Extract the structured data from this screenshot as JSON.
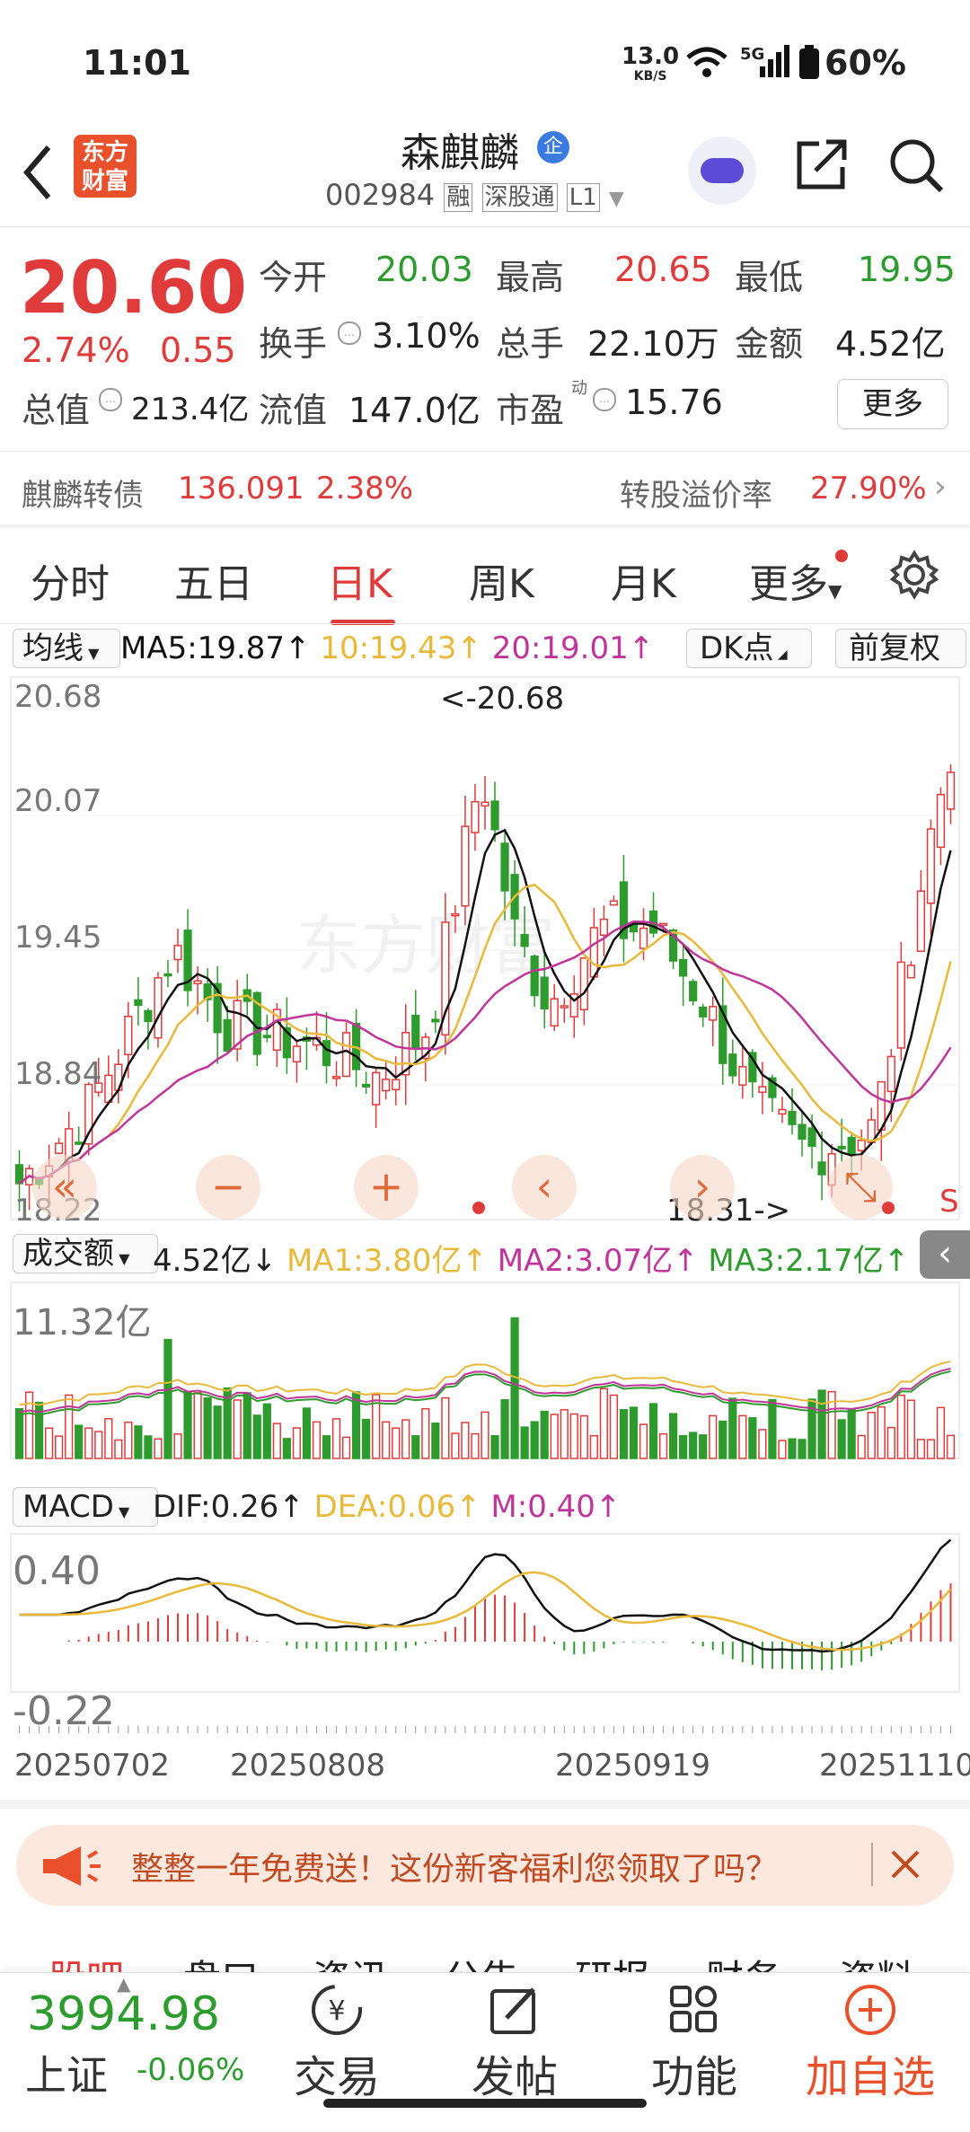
{
  "status": {
    "time": "11:01",
    "net_speed_top": "13.0",
    "net_speed_bottom": "KB/S",
    "signal": "5G",
    "battery": "60%"
  },
  "header": {
    "logo_top": "东方",
    "logo_bottom": "财富",
    "stock_name": "森麒麟",
    "badge": "企",
    "code": "002984",
    "tag1": "融",
    "tag2": "深股通",
    "tag3": "L1"
  },
  "quote": {
    "price": "20.60",
    "change_pct": "2.74%",
    "change_amt": "0.55",
    "open_label": "今开",
    "open": "20.03",
    "high_label": "最高",
    "high": "20.65",
    "low_label": "最低",
    "low": "19.95",
    "turnover_label": "换手",
    "turnover": "3.10%",
    "volume_label": "总手",
    "volume": "22.10万",
    "amount_label": "金额",
    "amount": "4.52亿",
    "mcap_label": "总值",
    "mcap": "213.4亿",
    "float_label": "流值",
    "float": "147.0亿",
    "pe_label": "市盈",
    "pe_sup": "动",
    "pe": "15.76",
    "more_button": "更多"
  },
  "bond": {
    "name": "麒麟转债",
    "price": "136.091",
    "pct": "2.38%",
    "premium_label": "转股溢价率",
    "premium": "27.90%"
  },
  "tabs": [
    "分时",
    "五日",
    "日K",
    "周K",
    "月K",
    "更多"
  ],
  "active_tab": 2,
  "kline": {
    "indicator_select": "均线",
    "ma5": "MA5:19.87",
    "ma10": "10:19.43",
    "ma20": "20:19.01",
    "dk_select": "DK点",
    "adjust_select": "前复权",
    "y_labels": [
      "20.68",
      "20.07",
      "19.45",
      "18.84",
      "18.22"
    ],
    "high_marker": "<-20.68",
    "low_marker": "18.31->",
    "s_marker": "S"
  },
  "volume": {
    "select": "成交额",
    "value": "4.52亿",
    "ma1": "MA1:3.80亿",
    "ma2": "MA2:3.07亿",
    "ma3": "MA3:2.17亿",
    "y_label": "11.32亿"
  },
  "macd": {
    "select": "MACD",
    "dif": "DIF:0.26",
    "dea": "DEA:0.06",
    "m": "M:0.40",
    "y_top": "0.40",
    "y_bottom": "-0.22"
  },
  "dates": [
    "20250702",
    "20250808",
    "20250919",
    "20251110"
  ],
  "banner": {
    "text": "整整一年免费送！这份新客福利您领取了吗？"
  },
  "section_tabs": [
    "股吧",
    "盘口",
    "资讯",
    "公告",
    "研报",
    "财务",
    "资料"
  ],
  "bottom": {
    "index_value": "3994.98",
    "index_name": "上证",
    "index_pct": "-0.06%",
    "trade": "交易",
    "post": "发帖",
    "func": "功能",
    "add": "加自选"
  },
  "colors": {
    "up": "#e03b3b",
    "down": "#2e9b2e",
    "ma5": "#111111",
    "ma10": "#e8b93a",
    "ma20": "#c0359a"
  },
  "chart_data": {
    "type": "candlestick",
    "x_range": [
      "20250702",
      "20251111"
    ],
    "price_axis": [
      18.22,
      20.68
    ],
    "series": [
      {
        "name": "MA5",
        "last": 19.87
      },
      {
        "name": "MA10",
        "last": 19.43
      },
      {
        "name": "MA20",
        "last": 19.01
      }
    ],
    "annotations": {
      "high": 20.68,
      "low": 18.31
    }
  }
}
